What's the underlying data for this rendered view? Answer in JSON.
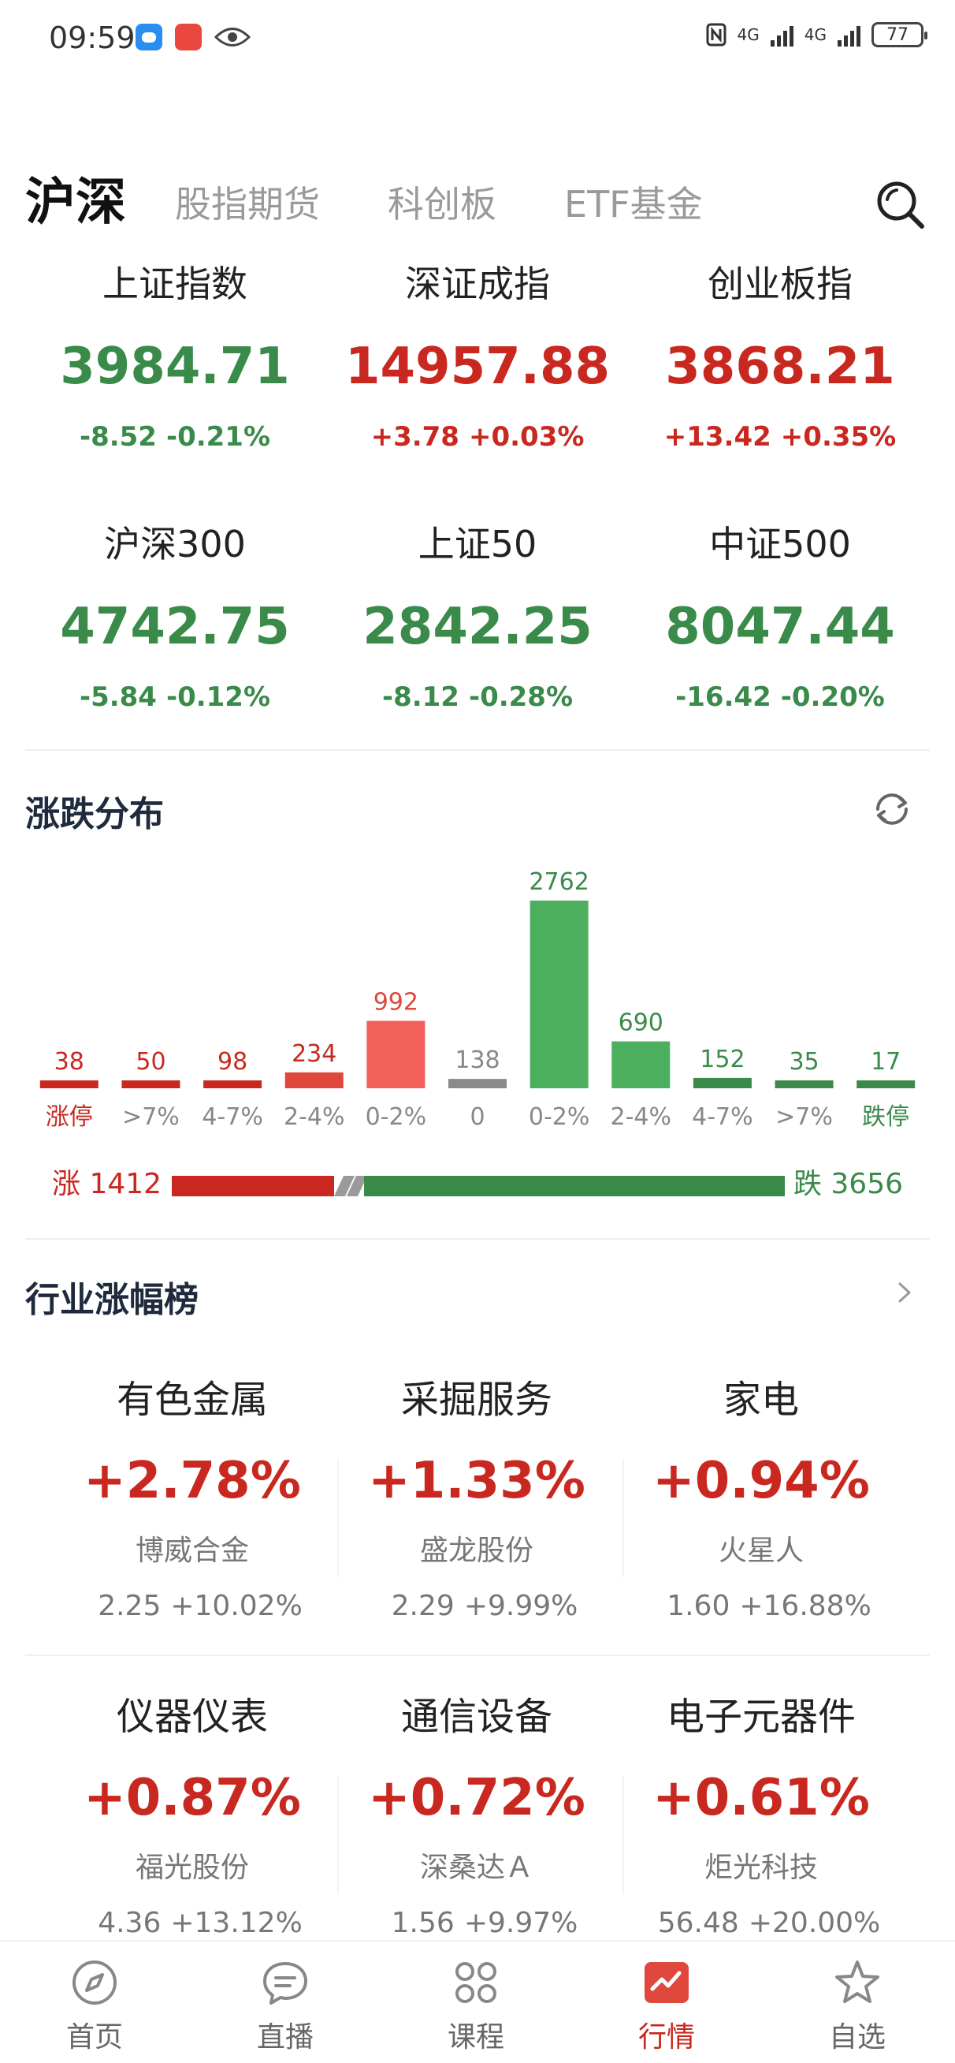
{
  "status_bar": {
    "time": "09:59",
    "battery": "77",
    "network_1": "4G",
    "network_2": "4G",
    "icons": [
      "chat-icon",
      "red-app-icon",
      "eye-icon",
      "nfc-icon",
      "signal-icon",
      "battery-icon"
    ]
  },
  "tabs": [
    {
      "label": "沪深",
      "active": true
    },
    {
      "label": "股指期货",
      "active": false
    },
    {
      "label": "科创板",
      "active": false
    },
    {
      "label": "ETF基金",
      "active": false
    }
  ],
  "indices": [
    {
      "name": "上证指数",
      "value": "3984.71",
      "change": "-8.52",
      "pct": "-0.21%",
      "trend": "down"
    },
    {
      "name": "深证成指",
      "value": "14957.88",
      "change": "+3.78",
      "pct": "+0.03%",
      "trend": "up"
    },
    {
      "name": "创业板指",
      "value": "3868.21",
      "change": "+13.42",
      "pct": "+0.35%",
      "trend": "up"
    },
    {
      "name": "沪深300",
      "value": "4742.75",
      "change": "-5.84",
      "pct": "-0.12%",
      "trend": "down"
    },
    {
      "name": "上证50",
      "value": "2842.25",
      "change": "-8.12",
      "pct": "-0.28%",
      "trend": "down"
    },
    {
      "name": "中证500",
      "value": "8047.44",
      "change": "-16.42",
      "pct": "-0.20%",
      "trend": "down"
    }
  ],
  "distribution": {
    "title": "涨跌分布",
    "up_label": "涨 1412",
    "down_label": "跌 3656",
    "up_count": 1412,
    "down_count": 3656
  },
  "chart_data": {
    "type": "bar",
    "title": "涨跌分布",
    "categories": [
      "涨停",
      ">7%",
      "4-7%",
      "2-4%",
      "0-2%",
      "0",
      "0-2%",
      "2-4%",
      "4-7%",
      ">7%",
      "跌停"
    ],
    "values": [
      38,
      50,
      98,
      234,
      992,
      138,
      2762,
      690,
      152,
      35,
      17
    ],
    "value_labels": [
      "38",
      "50",
      "98",
      "234",
      "992",
      "138",
      "2762",
      "690",
      "152",
      "35",
      "17"
    ],
    "colors": [
      "#c8281f",
      "#c8281f",
      "#c8281f",
      "#e0473d",
      "#f4605a",
      "#8a8a8a",
      "#4caf5e",
      "#4caf5e",
      "#3a8a4a",
      "#3a8a4a",
      "#3a8a4a"
    ],
    "label_colors": [
      "#c8281f",
      "#888888",
      "#888888",
      "#888888",
      "#888888",
      "#888888",
      "#888888",
      "#888888",
      "#888888",
      "#888888",
      "#3a8a4a"
    ],
    "value_colors": [
      "#c8281f",
      "#c8281f",
      "#c8281f",
      "#c8281f",
      "#e0473d",
      "#888888",
      "#3a8a4a",
      "#3a8a4a",
      "#3a8a4a",
      "#3a8a4a",
      "#3a8a4a"
    ]
  },
  "industry": {
    "title": "行业涨幅榜",
    "items": [
      {
        "name": "有色金属",
        "change": "+2.78%",
        "stock": "博威合金",
        "price": "2.25",
        "stock_pct": "+10.02%"
      },
      {
        "name": "采掘服务",
        "change": "+1.33%",
        "stock": "盛龙股份",
        "price": "2.29",
        "stock_pct": "+9.99%"
      },
      {
        "name": "家电",
        "change": "+0.94%",
        "stock": "火星人",
        "price": "1.60",
        "stock_pct": "+16.88%"
      },
      {
        "name": "仪器仪表",
        "change": "+0.87%",
        "stock": "福光股份",
        "price": "4.36",
        "stock_pct": "+13.12%"
      },
      {
        "name": "通信设备",
        "change": "+0.72%",
        "stock": "深桑达Ａ",
        "price": "1.56",
        "stock_pct": "+9.97%"
      },
      {
        "name": "电子元器件",
        "change": "+0.61%",
        "stock": "炬光科技",
        "price": "56.48",
        "stock_pct": "+20.00%"
      }
    ]
  },
  "nav": [
    {
      "label": "首页",
      "icon": "compass-icon",
      "active": false
    },
    {
      "label": "直播",
      "icon": "chat-bubble-icon",
      "active": false
    },
    {
      "label": "课程",
      "icon": "grid-icon",
      "active": false
    },
    {
      "label": "行情",
      "icon": "chart-icon",
      "active": true
    },
    {
      "label": "自选",
      "icon": "star-icon",
      "active": false
    }
  ],
  "colors": {
    "up": "#c8281f",
    "down": "#3a8a4a",
    "accent": "#e0473d"
  }
}
